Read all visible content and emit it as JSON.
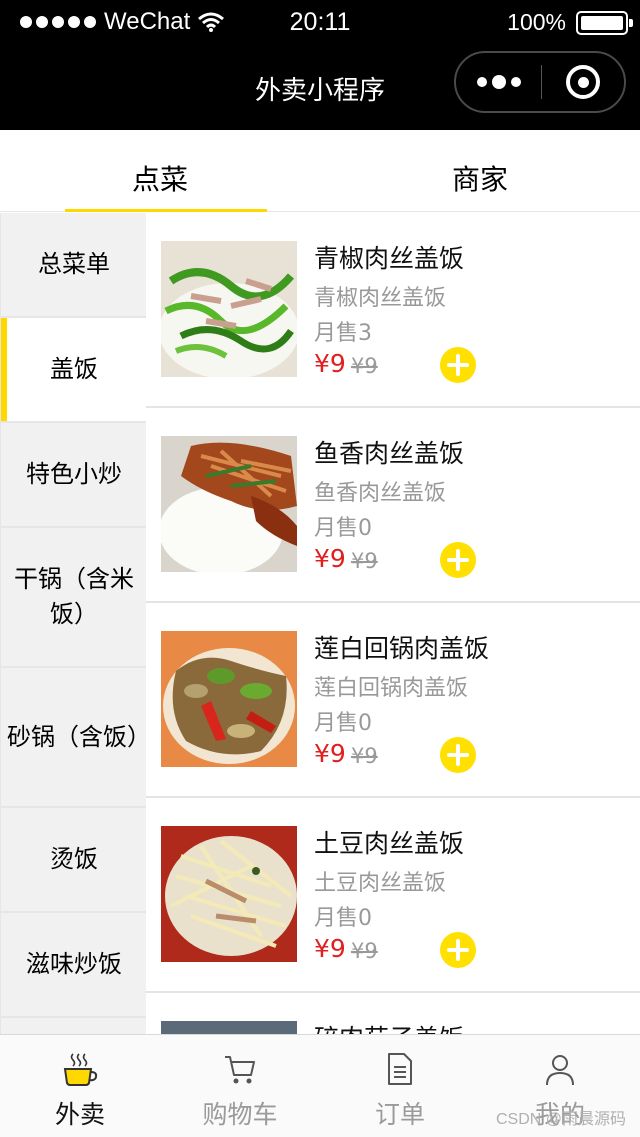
{
  "status_bar": {
    "carrier": "WeChat",
    "time": "20:11",
    "battery": "100%"
  },
  "nav": {
    "title": "外卖小程序"
  },
  "tabs": [
    {
      "label": "点菜",
      "active": true
    },
    {
      "label": "商家",
      "active": false
    }
  ],
  "categories": [
    {
      "label": "总菜单"
    },
    {
      "label": "盖饭",
      "active": true
    },
    {
      "label": "特色小炒"
    },
    {
      "label": "干锅（含米饭）"
    },
    {
      "label": "砂锅（含饭）"
    },
    {
      "label": "烫饭"
    },
    {
      "label": "滋味炒饭"
    }
  ],
  "dishes": [
    {
      "name": "青椒肉丝盖饭",
      "desc": "青椒肉丝盖饭",
      "sales": "月售3",
      "price": "¥9",
      "old_price": "¥9"
    },
    {
      "name": "鱼香肉丝盖饭",
      "desc": "鱼香肉丝盖饭",
      "sales": "月售0",
      "price": "¥9",
      "old_price": "¥9"
    },
    {
      "name": "莲白回锅肉盖饭",
      "desc": "莲白回锅肉盖饭",
      "sales": "月售0",
      "price": "¥9",
      "old_price": "¥9"
    },
    {
      "name": "土豆肉丝盖饭",
      "desc": "土豆肉丝盖饭",
      "sales": "月售0",
      "price": "¥9",
      "old_price": "¥9"
    },
    {
      "name": "碎肉茄子盖饭",
      "desc": "",
      "sales": "",
      "price": "",
      "old_price": ""
    }
  ],
  "tabbar": [
    {
      "label": "外卖",
      "icon": "coffee-cup-icon",
      "active": true
    },
    {
      "label": "购物车",
      "icon": "cart-icon",
      "active": false
    },
    {
      "label": "订单",
      "icon": "document-icon",
      "active": false
    },
    {
      "label": "我的",
      "icon": "user-icon",
      "active": false
    }
  ],
  "watermark": "CSDN @雨晨源码",
  "colors": {
    "accent": "#ffd800",
    "price": "#e02020",
    "nav_bg": "#000000"
  }
}
